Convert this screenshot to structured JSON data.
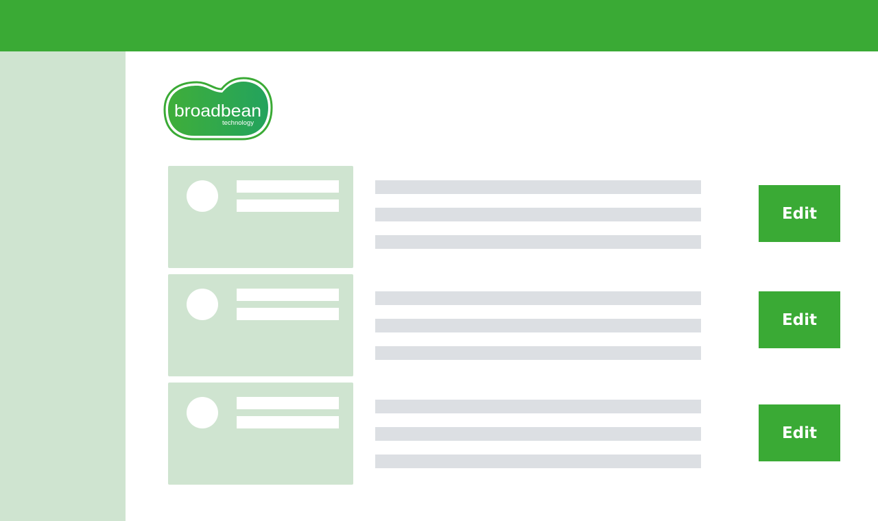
{
  "brand": {
    "name": "broadbean",
    "sub": "technology"
  },
  "colors": {
    "primary_green": "#3aaa35",
    "light_green": "#cfe4d0",
    "placeholder_gray": "#dcdfe3",
    "white": "#ffffff"
  },
  "rows": [
    {
      "edit_label": "Edit"
    },
    {
      "edit_label": "Edit"
    },
    {
      "edit_label": "Edit"
    }
  ]
}
